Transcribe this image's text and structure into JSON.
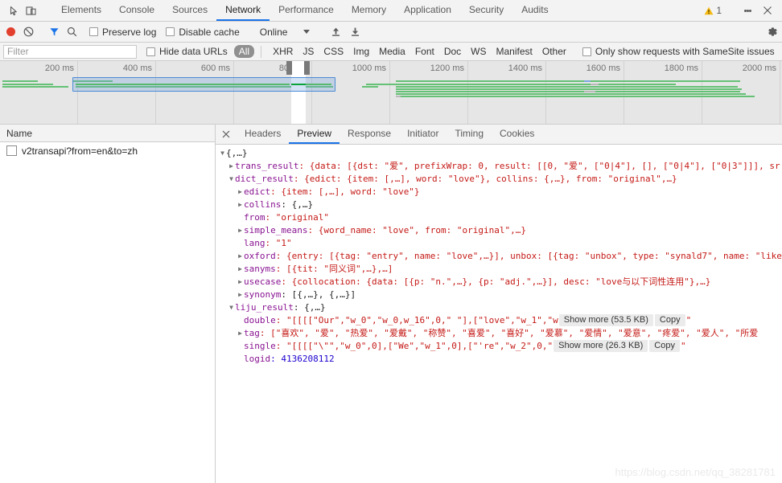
{
  "main_tabs": [
    {
      "label": "Elements",
      "active": false
    },
    {
      "label": "Console",
      "active": false
    },
    {
      "label": "Sources",
      "active": false
    },
    {
      "label": "Network",
      "active": true
    },
    {
      "label": "Performance",
      "active": false
    },
    {
      "label": "Memory",
      "active": false
    },
    {
      "label": "Application",
      "active": false
    },
    {
      "label": "Security",
      "active": false
    },
    {
      "label": "Audits",
      "active": false
    }
  ],
  "titlebar": {
    "inspect_icon": "inspect-cursor-icon",
    "device_icon": "device-toolbar-icon",
    "warning_count": "1",
    "warning_icon": "warning-triangle-icon",
    "more_icon": "kebab-menu-icon",
    "close_icon": "close-icon"
  },
  "toolbar": {
    "record_icon": "record-button",
    "clear_icon": "clear-icon",
    "filter_icon": "funnel-filter-icon",
    "search_icon": "search-icon",
    "preserve_log_label": "Preserve log",
    "preserve_log_checked": false,
    "disable_cache_label": "Disable cache",
    "disable_cache_checked": false,
    "throttle_value": "Online",
    "import_icon": "upload-arrow-icon",
    "export_icon": "download-arrow-icon",
    "settings_icon": "gear-icon"
  },
  "filterbar": {
    "filter_placeholder": "Filter",
    "filter_value": "",
    "hide_data_urls_label": "Hide data URLs",
    "hide_data_urls_checked": false,
    "types": [
      {
        "label": "All",
        "active": true
      },
      {
        "label": "XHR",
        "active": false
      },
      {
        "label": "JS",
        "active": false
      },
      {
        "label": "CSS",
        "active": false
      },
      {
        "label": "Img",
        "active": false
      },
      {
        "label": "Media",
        "active": false
      },
      {
        "label": "Font",
        "active": false
      },
      {
        "label": "Doc",
        "active": false
      },
      {
        "label": "WS",
        "active": false
      },
      {
        "label": "Manifest",
        "active": false
      },
      {
        "label": "Other",
        "active": false
      }
    ],
    "samesite_label": "Only show requests with SameSite issues",
    "samesite_checked": false
  },
  "overview": {
    "ticks": [
      "200 ms",
      "400 ms",
      "600 ms",
      "800 ms",
      "1000 ms",
      "1200 ms",
      "1400 ms",
      "1600 ms",
      "1800 ms",
      "2000 ms"
    ]
  },
  "requests": {
    "column_header": "Name",
    "rows": [
      {
        "name": "v2transapi?from=en&to=zh"
      }
    ]
  },
  "detail_tabs": [
    {
      "label": "Headers",
      "active": false
    },
    {
      "label": "Preview",
      "active": true
    },
    {
      "label": "Response",
      "active": false
    },
    {
      "label": "Initiator",
      "active": false
    },
    {
      "label": "Timing",
      "active": false
    },
    {
      "label": "Cookies",
      "active": false
    }
  ],
  "preview": {
    "root": "{,…}",
    "rows": [
      {
        "key": "trans_result",
        "value": ": {data: [{dst: \"爱\", prefixWrap: 0, result: [[0, \"爱\", [\"0|4\"], [], [\"0|4\"], [\"0|3\"]]], sr"
      },
      {
        "key": "dict_result",
        "value": ": {edict: {item: [,…], word: \"love\"}, collins: {,…}, from: \"original\",…}"
      },
      {
        "key": "edict",
        "value": ": {item: [,…], word: \"love\"}"
      },
      {
        "key": "collins",
        "value": ": {,…}"
      },
      {
        "key": "from",
        "value": ": \"original\""
      },
      {
        "key": "simple_means",
        "value": ": {word_name: \"love\", from: \"original\",…}"
      },
      {
        "key": "lang",
        "value": ": \"1\""
      },
      {
        "key": "oxford",
        "value": ": {entry: [{tag: \"entry\", name: \"love\",…}], unbox: [{tag: \"unbox\", type: \"synald7\", name: \"like"
      },
      {
        "key": "sanyms",
        "value": ": [{tit: \"同义词\",…},…]"
      },
      {
        "key": "usecase",
        "value": ": {collocation: {data: [{p: \"n.\",…}, {p: \"adj.\",…}], desc: \"love与以下词性连用\"},…}"
      },
      {
        "key": "synonym",
        "value": ": [{,…}, {,…}]"
      },
      {
        "key": "liju_result",
        "value": ": {,…}"
      },
      {
        "key": "double",
        "value": ": \"[[[[\"Our\",\"w_0\",\"w_0,w_16\",0,\" \"],[\"love\",\"w_1\",\"w"
      },
      {
        "key": "tag",
        "value": ": [\"喜欢\", \"爱\", \"热爱\", \"爱戴\", \"称赞\", \"喜爱\", \"喜好\", \"爱慕\", \"爱情\", \"爱意\", \"疼爱\", \"爱人\", \"所爱"
      },
      {
        "key": "single",
        "value": ": \"[[[[\"\\\"\",\"w_0\",0],[\"We\",\"w_1\",0],[\"'re\",\"w_2\",0,\""
      },
      {
        "key": "logid",
        "value": ": 4136208112"
      }
    ],
    "double_show_more": "Show more (53.5 KB)",
    "double_copy": "Copy",
    "single_show_more": "Show more (26.3 KB)",
    "single_copy": "Copy",
    "trailing_quote": "\""
  },
  "watermark": "https://blog.csdn.net/qq_38281781"
}
